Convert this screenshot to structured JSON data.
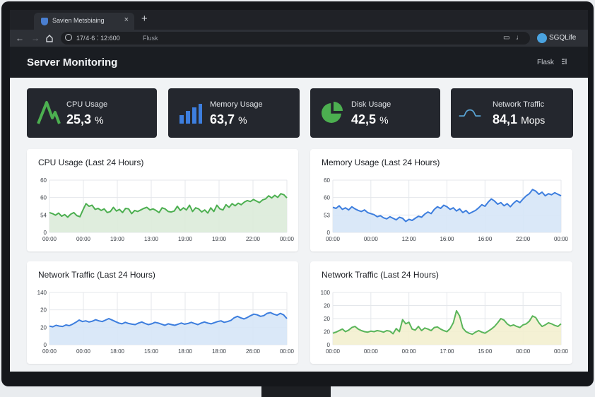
{
  "browser": {
    "tab_title": "Savien Metsbiaing",
    "tab_close": "×",
    "new_tab": "+",
    "url": "17/ 4·6 ⁚ 12:600",
    "url_path": "Flusk",
    "profile_name": "SGQLife"
  },
  "header": {
    "title": "Server Monitoring",
    "nav_label": "Flask"
  },
  "stats": [
    {
      "label": "CPU Usage",
      "value": "25,3",
      "unit": "%",
      "icon": "cpu-spike-icon",
      "color": "#4caf50"
    },
    {
      "label": "Memory Usage",
      "value": "63,7",
      "unit": "%",
      "icon": "bar-chart-icon",
      "color": "#3d7ede"
    },
    {
      "label": "Disk Usage",
      "value": "42,5",
      "unit": "%",
      "icon": "pie-chart-icon",
      "color": "#4caf50"
    },
    {
      "label": "Network Traffic",
      "value": "84,1",
      "unit": "Mops",
      "icon": "pulse-icon",
      "color": "#5aa5d6"
    }
  ],
  "chart_data": [
    {
      "type": "area",
      "title": "CPU Usage (Last 24 Hours)",
      "color": "#4caf50",
      "fill": "#dcebd9",
      "y_ticks": [
        "60",
        "60",
        "54",
        "0"
      ],
      "ylim": [
        0,
        100
      ],
      "x_ticks": [
        "00:00",
        "00:00",
        "19:00",
        "13:00",
        "19:00",
        "19:00",
        "22:00",
        "00:00"
      ],
      "grid": true,
      "values": [
        38,
        36,
        33,
        37,
        31,
        34,
        29,
        35,
        38,
        32,
        30,
        43,
        55,
        50,
        52,
        44,
        46,
        42,
        45,
        38,
        40,
        48,
        41,
        44,
        38,
        46,
        45,
        36,
        42,
        40,
        43,
        46,
        48,
        43,
        45,
        42,
        38,
        47,
        45,
        40,
        39,
        41,
        50,
        42,
        47,
        43,
        52,
        40,
        47,
        45,
        39,
        43,
        37,
        47,
        40,
        52,
        45,
        43,
        53,
        48,
        55,
        51,
        56,
        53,
        58,
        61,
        59,
        63,
        60,
        57,
        62,
        64,
        70,
        66,
        71,
        67,
        74,
        72,
        66
      ]
    },
    {
      "type": "area",
      "title": "Memory Usage (Last 24 Hours)",
      "color": "#3d7ede",
      "fill": "#d6e5f7",
      "y_ticks": [
        "60",
        "60",
        "53",
        "0"
      ],
      "ylim": [
        0,
        100
      ],
      "x_ticks": [
        "00:00",
        "00:00",
        "12:00",
        "16:00",
        "16:00",
        "22:00",
        "00:00"
      ],
      "grid": true,
      "values": [
        48,
        46,
        51,
        44,
        47,
        43,
        49,
        45,
        42,
        40,
        43,
        38,
        36,
        34,
        30,
        32,
        28,
        26,
        30,
        27,
        24,
        29,
        27,
        21,
        25,
        23,
        27,
        31,
        29,
        35,
        39,
        36,
        44,
        49,
        46,
        52,
        49,
        44,
        47,
        41,
        45,
        38,
        42,
        36,
        39,
        42,
        47,
        53,
        50,
        58,
        64,
        60,
        54,
        57,
        51,
        55,
        49,
        56,
        61,
        57,
        64,
        70,
        74,
        82,
        79,
        73,
        77,
        70,
        74,
        72,
        76,
        73,
        70
      ]
    },
    {
      "type": "area",
      "title": "Network Traffic (Last 24 Hours)",
      "color": "#3d7ede",
      "fill": "#d6e5f7",
      "y_ticks": [
        "140",
        "20",
        "20",
        "0"
      ],
      "ylim": [
        0,
        140
      ],
      "x_ticks": [
        "00:00",
        "00:00",
        "18:00",
        "15:00",
        "18:00",
        "18:00",
        "26:00",
        "00:00"
      ],
      "grid": true,
      "values": [
        50,
        48,
        52,
        50,
        49,
        53,
        51,
        55,
        60,
        66,
        62,
        64,
        61,
        63,
        67,
        64,
        62,
        66,
        70,
        66,
        62,
        58,
        56,
        60,
        57,
        55,
        54,
        58,
        61,
        57,
        54,
        56,
        60,
        58,
        55,
        52,
        56,
        54,
        52,
        55,
        58,
        55,
        57,
        60,
        57,
        54,
        58,
        61,
        58,
        56,
        59,
        62,
        64,
        60,
        62,
        65,
        72,
        76,
        72,
        69,
        73,
        78,
        82,
        80,
        76,
        78,
        84,
        86,
        82,
        79,
        84,
        80,
        70
      ]
    },
    {
      "type": "area",
      "title": "Network Traffic (Last 24 Hours)",
      "color": "#5ab55a",
      "fill": "#f3f0cf",
      "y_ticks": [
        "100",
        "20",
        "20",
        "20",
        "0"
      ],
      "ylim": [
        0,
        100
      ],
      "x_ticks": [
        "00:00",
        "00:00",
        "00:00",
        "17:00",
        "15:00",
        "00:00",
        "00:00"
      ],
      "grid": true,
      "values": [
        22,
        24,
        27,
        30,
        25,
        28,
        33,
        35,
        30,
        27,
        25,
        24,
        26,
        25,
        27,
        26,
        24,
        27,
        26,
        21,
        31,
        25,
        48,
        40,
        43,
        30,
        28,
        35,
        27,
        32,
        30,
        27,
        33,
        34,
        30,
        27,
        25,
        31,
        42,
        65,
        55,
        32,
        25,
        22,
        20,
        24,
        27,
        24,
        22,
        26,
        30,
        35,
        42,
        50,
        47,
        40,
        36,
        38,
        35,
        33,
        38,
        40,
        45,
        55,
        52,
        42,
        35,
        38,
        42,
        40,
        37,
        35,
        40
      ]
    }
  ]
}
